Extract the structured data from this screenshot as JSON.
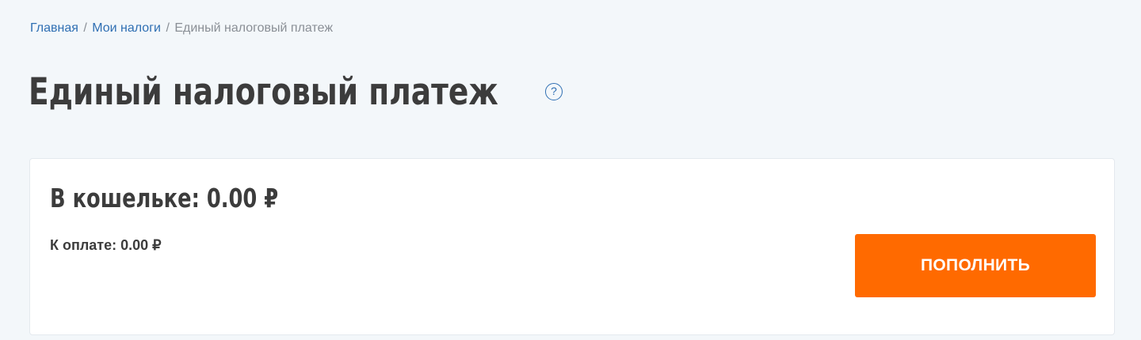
{
  "breadcrumb": {
    "items": [
      {
        "label": "Главная"
      },
      {
        "label": "Мои налоги"
      }
    ],
    "separator": "/",
    "current": "Единый налоговый платеж"
  },
  "page": {
    "title": "Единый налоговый платеж",
    "help_icon_glyph": "?"
  },
  "wallet": {
    "balance_text": "В кошельке: 0.00 ₽",
    "to_pay_text": "К оплате: 0.00 ₽",
    "topup_button_label": "ПОПОЛНИТЬ"
  },
  "colors": {
    "background": "#f3f7fa",
    "link": "#2f6fb3",
    "accent_button": "#ff6a00",
    "text": "#3c3c3c",
    "muted": "#8a8f96"
  },
  "icons": {
    "help": "question-circle-icon"
  }
}
